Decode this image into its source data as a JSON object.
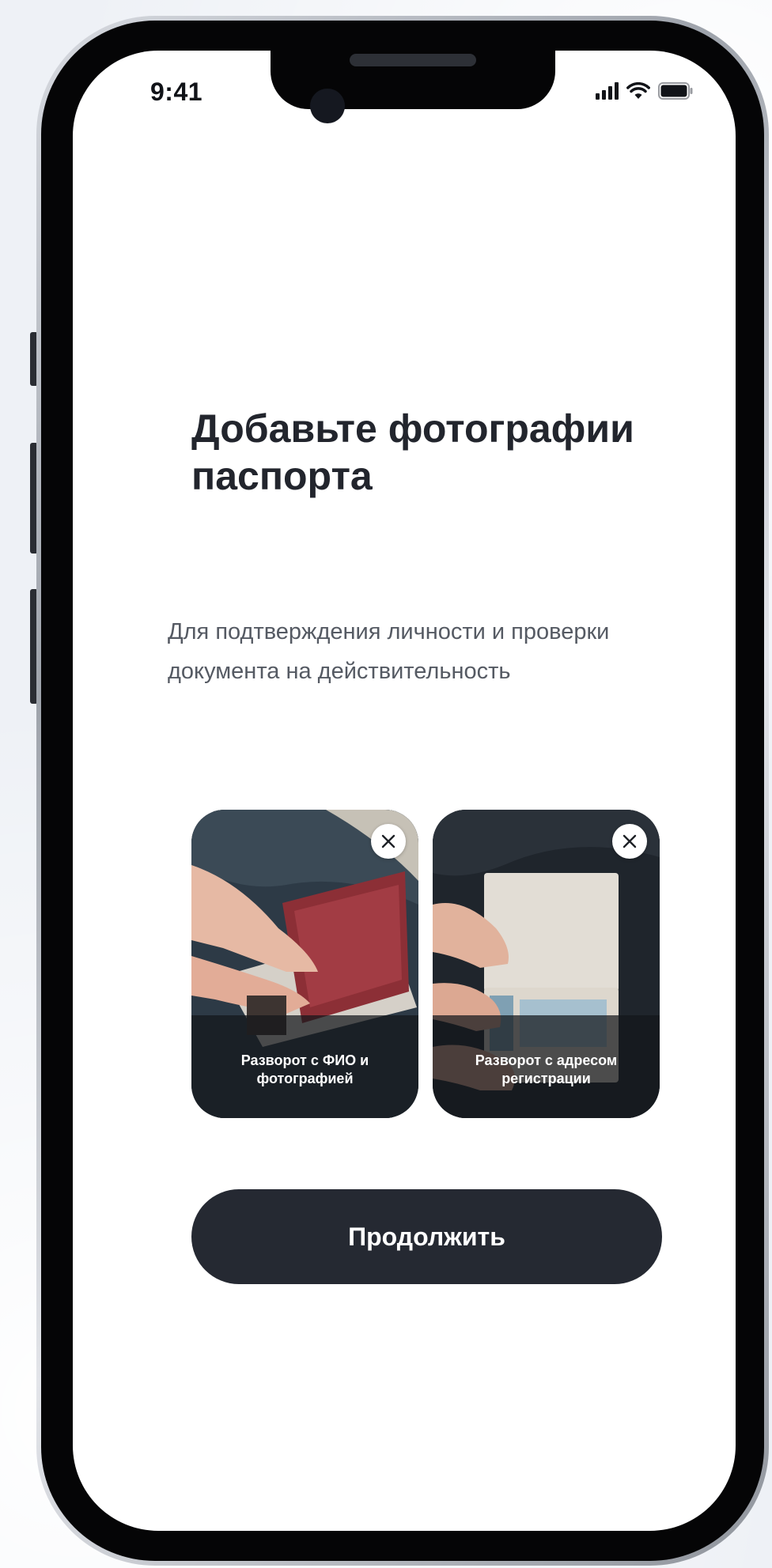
{
  "status_bar": {
    "time": "9:41",
    "icons": [
      "cellular-signal-icon",
      "wifi-icon",
      "battery-icon"
    ]
  },
  "header": {
    "title": "Добавьте фотографии паспорта",
    "subtitle": "Для подтверждения личности и проверки документа на действительность"
  },
  "photo_cards": [
    {
      "label": "Разворот с ФИО и фотографией",
      "remove_icon": "close-icon"
    },
    {
      "label": "Разворот с адресом регистрации",
      "remove_icon": "close-icon"
    }
  ],
  "actions": {
    "continue_label": "Продолжить"
  },
  "colors": {
    "button_bg": "#252932",
    "title_text": "#22252d",
    "subtitle_text": "#555a63",
    "screen_bg": "#ffffff"
  }
}
